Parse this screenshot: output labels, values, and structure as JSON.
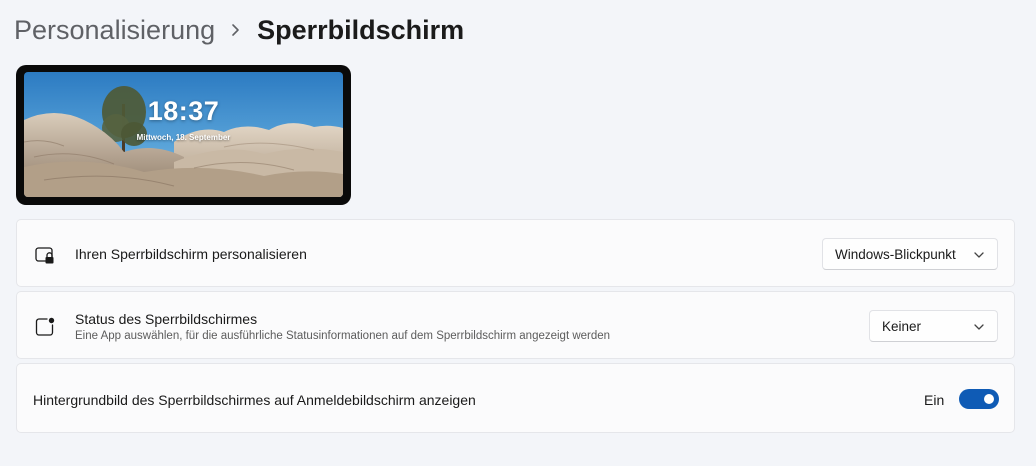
{
  "breadcrumb": {
    "parent": "Personalisierung",
    "current": "Sperrbildschirm"
  },
  "preview": {
    "time": "18:37",
    "date": "Mittwoch, 18. September"
  },
  "settings": {
    "personalize": {
      "icon": "lock-screen-icon",
      "title": "Ihren Sperrbildschirm personalisieren",
      "value": "Windows-Blickpunkt"
    },
    "status": {
      "icon": "app-status-icon",
      "title": "Status des Sperrbildschirmes",
      "description": "Eine App auswählen, für die ausführliche Statusinformationen auf dem Sperrbildschirm angezeigt werden",
      "value": "Keiner"
    },
    "signin_background": {
      "title": "Hintergrundbild des Sperrbildschirmes auf Anmeldebildschirm anzeigen",
      "state_label": "Ein",
      "enabled": true
    }
  },
  "colors": {
    "background": "#f3f5f9",
    "card": "#fbfbfc",
    "accent": "#0f5bb5"
  }
}
